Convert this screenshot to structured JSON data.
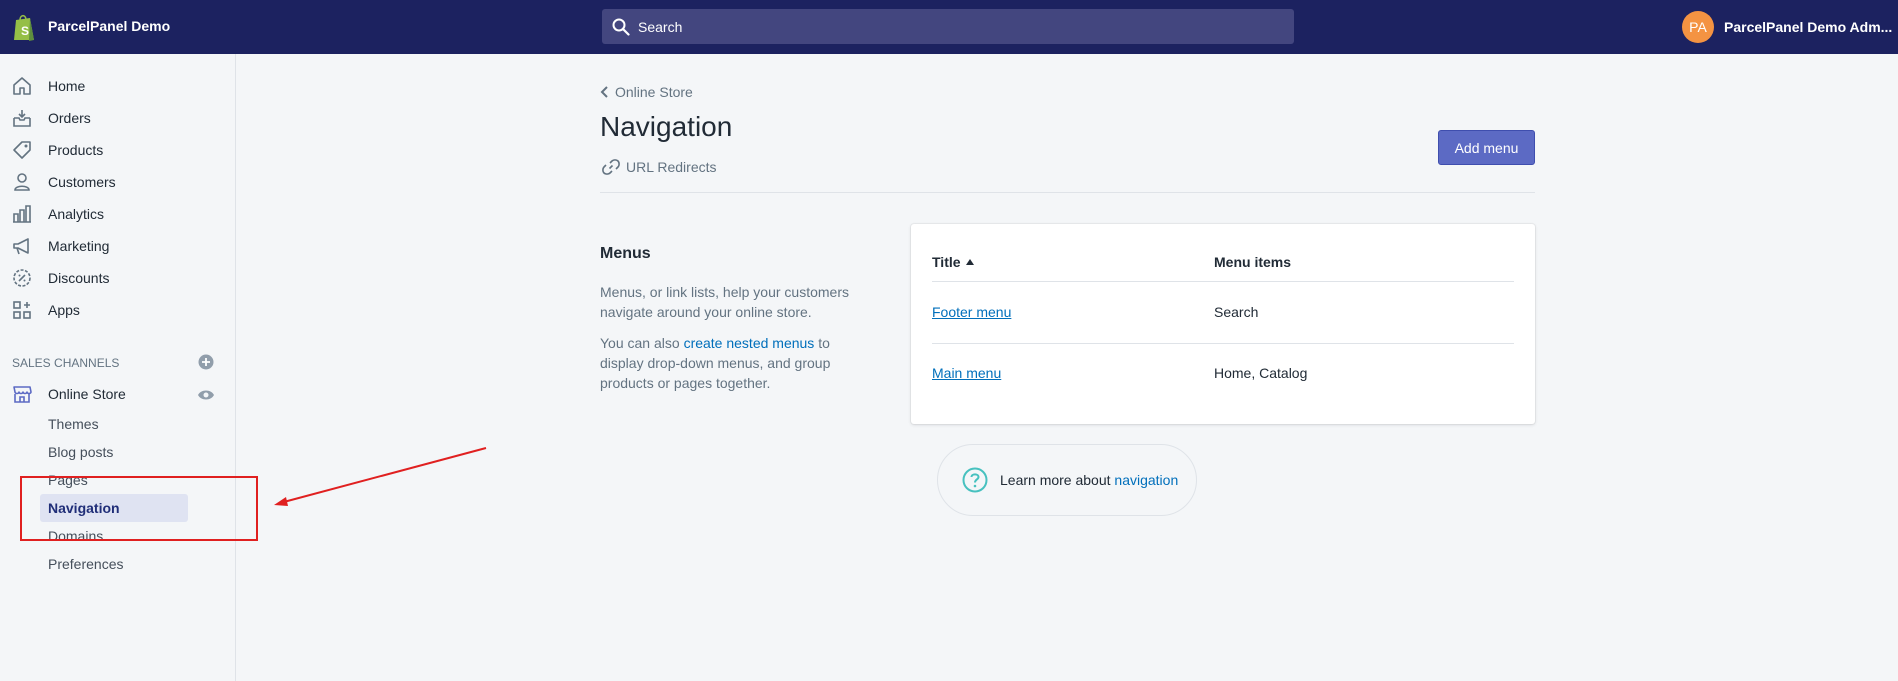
{
  "topbar": {
    "store_name": "ParcelPanel Demo",
    "search_placeholder": "Search",
    "avatar_initials": "PA",
    "user_name": "ParcelPanel Demo Adm..."
  },
  "sidebar": {
    "items": [
      {
        "label": "Home",
        "icon": "home-icon"
      },
      {
        "label": "Orders",
        "icon": "orders-icon"
      },
      {
        "label": "Products",
        "icon": "tag-icon"
      },
      {
        "label": "Customers",
        "icon": "person-icon"
      },
      {
        "label": "Analytics",
        "icon": "bar-chart-icon"
      },
      {
        "label": "Marketing",
        "icon": "megaphone-icon"
      },
      {
        "label": "Discounts",
        "icon": "discount-icon"
      },
      {
        "label": "Apps",
        "icon": "apps-icon"
      }
    ],
    "sales_channels_title": "SALES CHANNELS",
    "online_store": "Online Store",
    "sub_items": [
      "Themes",
      "Blog posts",
      "Pages",
      "Navigation",
      "Domains",
      "Preferences"
    ],
    "active_sub_item": "Navigation"
  },
  "main": {
    "breadcrumb": "Online Store",
    "title": "Navigation",
    "url_redirects": "URL Redirects",
    "add_menu_label": "Add menu",
    "menus_heading": "Menus",
    "desc1": "Menus, or link lists, help your customers navigate around your online store.",
    "desc2_prefix": "You can also ",
    "desc2_link": "create nested menus",
    "desc2_suffix": " to display drop-down menus, and group products or pages together.",
    "table": {
      "col_title": "Title",
      "col_items": "Menu items",
      "rows": [
        {
          "title": "Footer menu",
          "items": "Search"
        },
        {
          "title": "Main menu",
          "items": "Home, Catalog"
        }
      ]
    },
    "learn_prefix": "Learn more about ",
    "learn_link": "navigation"
  },
  "colors": {
    "topbar": "#1c2260",
    "accent": "#5c6ac4",
    "link": "#006fbb",
    "annotation": "#e02020"
  }
}
